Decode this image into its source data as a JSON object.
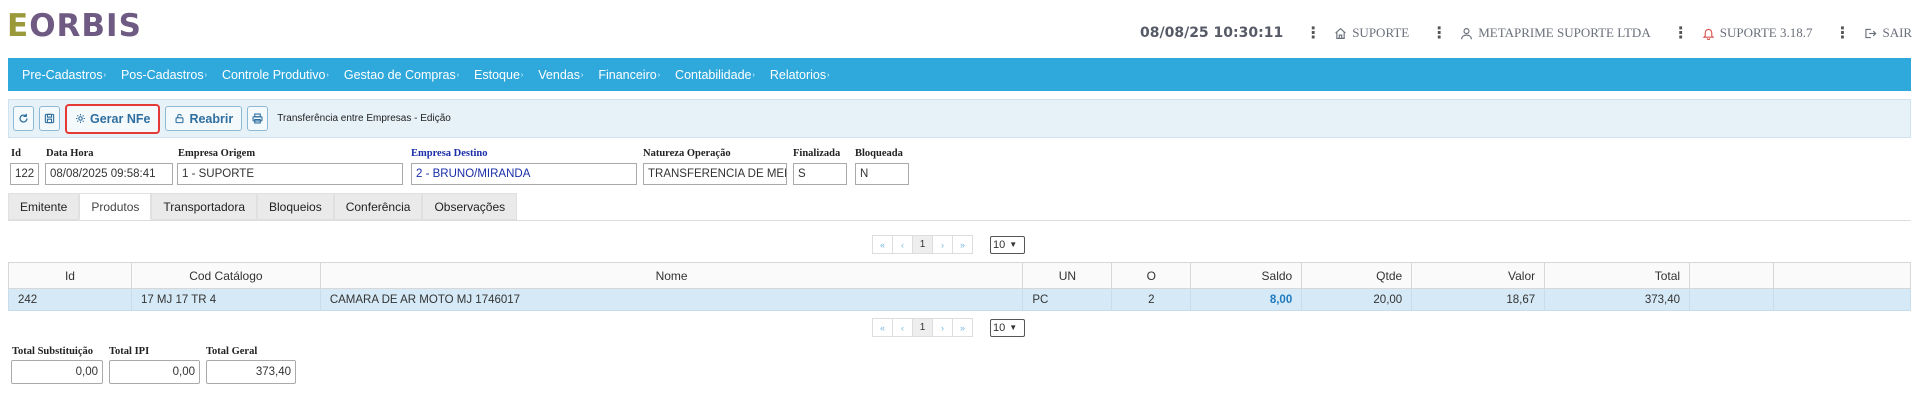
{
  "header": {
    "logo_e": "E",
    "logo_rest": "ORBIS",
    "datetime": "08/08/25 10:30:11",
    "user_area": "SUPORTE",
    "company": "METAPRIME SUPORTE LTDA",
    "version": "SUPORTE 3.18.7",
    "logout": "SAIR"
  },
  "menu": [
    {
      "label": "Pre-Cadastros"
    },
    {
      "label": "Pos-Cadastros"
    },
    {
      "label": "Controle Produtivo"
    },
    {
      "label": "Gestao de Compras"
    },
    {
      "label": "Estoque"
    },
    {
      "label": "Vendas"
    },
    {
      "label": "Financeiro"
    },
    {
      "label": "Contabilidade"
    },
    {
      "label": "Relatorios"
    }
  ],
  "toolbar": {
    "gerar_nfe": "Gerar NFe",
    "reabrir": "Reabrir",
    "title": "Transferência entre Empresas - Edição"
  },
  "form": {
    "id_label": "Id",
    "id_value": "122",
    "datahora_label": "Data Hora",
    "datahora_value": "08/08/2025 09:58:41",
    "origem_label": "Empresa Origem",
    "origem_value": "1 - SUPORTE",
    "destino_label": "Empresa Destino",
    "destino_value": "2 - BRUNO/MIRANDA",
    "natureza_label": "Natureza Operação",
    "natureza_value": "TRANSFERENCIA DE MERCADORIA",
    "finalizada_label": "Finalizada",
    "finalizada_value": "S",
    "bloqueada_label": "Bloqueada",
    "bloqueada_value": "N"
  },
  "tabs": [
    {
      "label": "Emitente"
    },
    {
      "label": "Produtos",
      "active": true
    },
    {
      "label": "Transportadora"
    },
    {
      "label": "Bloqueios"
    },
    {
      "label": "Conferência"
    },
    {
      "label": "Observações"
    }
  ],
  "pager": {
    "first": "«",
    "prev": "‹",
    "page": "1",
    "next": "›",
    "last": "»",
    "page_size": "10"
  },
  "table": {
    "columns": [
      "Id",
      "Cod Catálogo",
      "Nome",
      "UN",
      "O",
      "Saldo",
      "Qtde",
      "Valor",
      "Total",
      "",
      ""
    ],
    "rows": [
      {
        "id": "242",
        "cod": "17 MJ 17 TR 4",
        "nome": "CAMARA DE AR MOTO MJ 1746017",
        "un": "PC",
        "o": "2",
        "saldo": "8,00",
        "qtde": "20,00",
        "valor": "18,67",
        "total": "373,40"
      }
    ]
  },
  "totals": {
    "subst_label": "Total Substituição",
    "subst_value": "0,00",
    "ipi_label": "Total IPI",
    "ipi_value": "0,00",
    "geral_label": "Total Geral",
    "geral_value": "373,40"
  }
}
